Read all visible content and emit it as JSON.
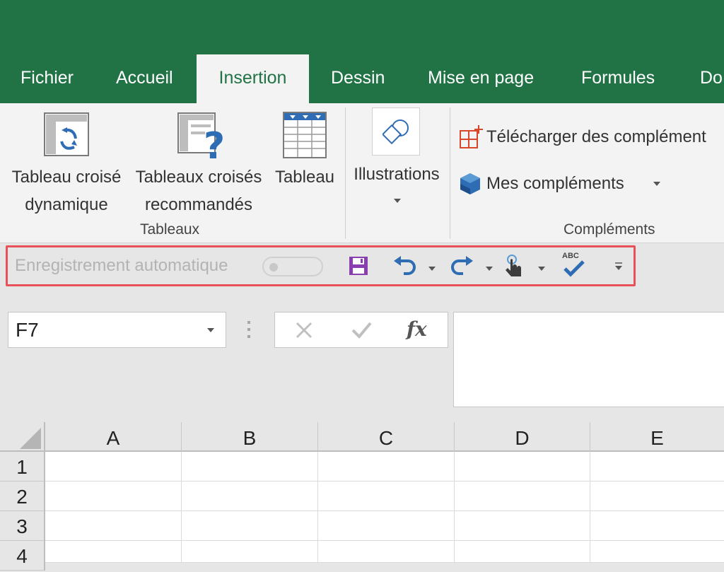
{
  "tabs": [
    {
      "label": "Fichier",
      "active": false
    },
    {
      "label": "Accueil",
      "active": false
    },
    {
      "label": "Insertion",
      "active": true
    },
    {
      "label": "Dessin",
      "active": false
    },
    {
      "label": "Mise en page",
      "active": false
    },
    {
      "label": "Formules",
      "active": false
    },
    {
      "label": "Do",
      "active": false
    }
  ],
  "ribbon": {
    "tableaux": {
      "pivot_line1": "Tableau croisé",
      "pivot_line2": "dynamique",
      "recommended_line1": "Tableaux croisés",
      "recommended_line2": "recommandés",
      "table_label": "Tableau",
      "group_label": "Tableaux"
    },
    "illustrations": {
      "label": "Illustrations"
    },
    "complements": {
      "download_label": "Télécharger des complément",
      "mine_label": "Mes compléments",
      "group_label": "Compléments"
    }
  },
  "qat": {
    "autosave_label": "Enregistrement automatique",
    "spell_badge": "ABC"
  },
  "formula_bar": {
    "name_box_value": "F7",
    "fx_label": "fx",
    "formula_value": ""
  },
  "grid": {
    "columns": [
      "A",
      "B",
      "C",
      "D",
      "E"
    ],
    "rows": [
      "1",
      "2",
      "3",
      "4"
    ]
  },
  "colors": {
    "brand": "#217346",
    "qat_highlight": "#e8505b",
    "save_icon": "#8a3fb0",
    "undo_redo": "#2e6db4"
  }
}
